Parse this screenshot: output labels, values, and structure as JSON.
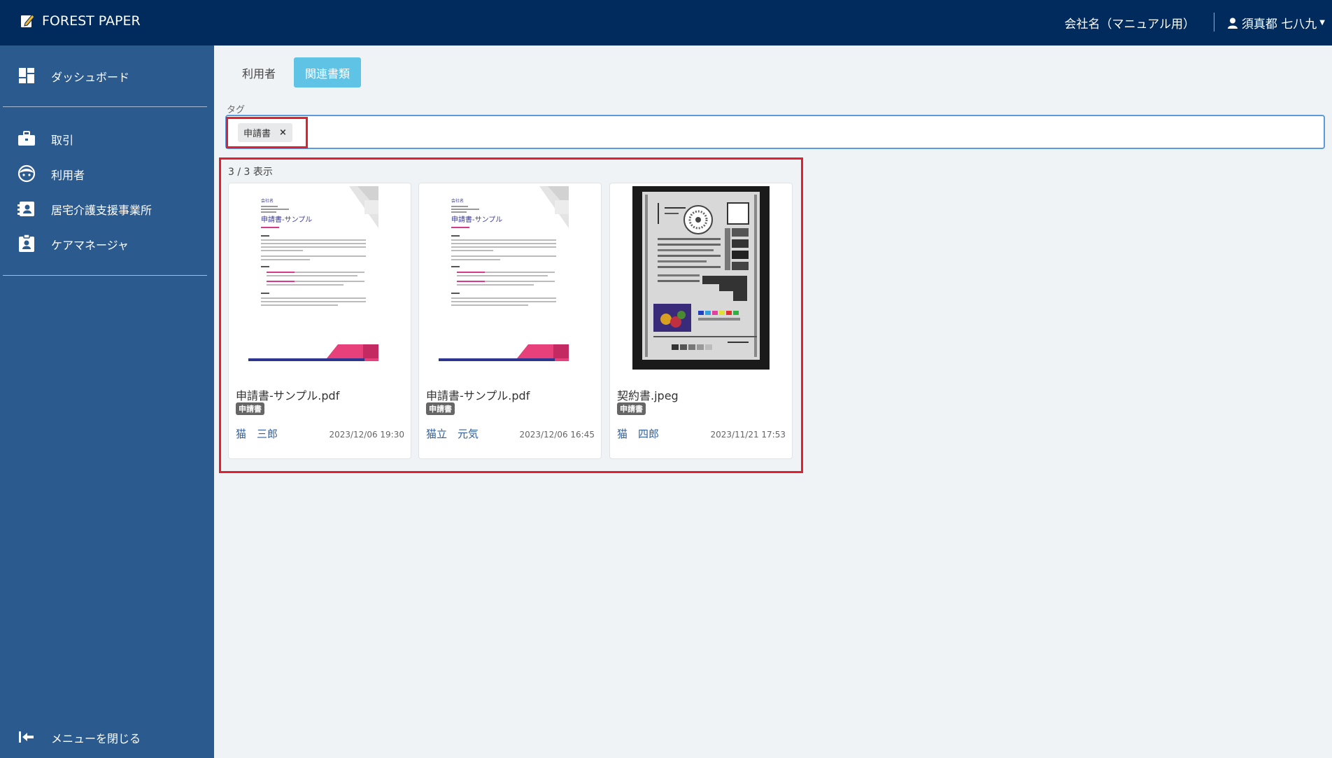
{
  "header": {
    "brand": "FOREST PAPER",
    "company": "会社名（マニュアル用）",
    "user": "須真都 七八九"
  },
  "sidebar": {
    "items": [
      {
        "label": "ダッシュボード",
        "icon": "dashboard-icon"
      },
      {
        "label": "取引",
        "icon": "briefcase-icon"
      },
      {
        "label": "利用者",
        "icon": "face-icon"
      },
      {
        "label": "居宅介護支援事業所",
        "icon": "contact-card-icon"
      },
      {
        "label": "ケアマネージャ",
        "icon": "clipboard-user-icon"
      }
    ],
    "close_menu": "メニューを閉じる"
  },
  "tabs": [
    {
      "label": "利用者",
      "active": false
    },
    {
      "label": "関連書類",
      "active": true
    }
  ],
  "filter": {
    "tag_label": "タグ",
    "chip": "申請書",
    "chip_remove": "×"
  },
  "results": {
    "count": "3 / 3 表示",
    "cards": [
      {
        "filename": "申請書-サンプル.pdf",
        "tag": "申請書",
        "owner": "猫　三郎",
        "date": "2023/12/06 19:30",
        "doc": {
          "company": "会社名",
          "title": "申請書-サンプル"
        }
      },
      {
        "filename": "申請書-サンプル.pdf",
        "tag": "申請書",
        "owner": "猫立　元気",
        "date": "2023/12/06 16:45",
        "doc": {
          "company": "会社名",
          "title": "申請書-サンプル"
        }
      },
      {
        "filename": "契約書.jpeg",
        "tag": "申請書",
        "owner": "猫　四郎",
        "date": "2023/11/21 17:53"
      }
    ]
  },
  "colors": {
    "topbar": "#002b5c",
    "sidebar": "#2b5a8e",
    "active_tab": "#5fc3e6",
    "highlight": "#e02030"
  }
}
